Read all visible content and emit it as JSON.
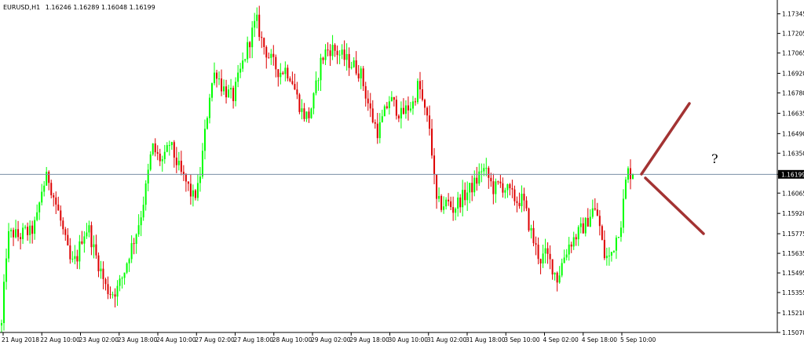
{
  "header": {
    "symbol": "EURUSD,H1",
    "ohlc_readout": "1.16246 1.16289 1.16048 1.16199"
  },
  "annotation": {
    "question_mark": "?"
  },
  "colors": {
    "background": "#ffffff",
    "bull_candle": "#00ff00",
    "bear_candle": "#dd0000",
    "current_price_line": "#7a8fa6",
    "forecast_arrows": "#a33333",
    "axis": "#000000"
  },
  "chart_data": {
    "type": "candlestick",
    "symbol": "EURUSD",
    "timeframe": "H1",
    "current_price": 1.16199,
    "y_range": [
      1.1507,
      1.1741
    ],
    "y_ticks": [
      "1.17345",
      "1.17205",
      "1.17065",
      "1.16920",
      "1.16780",
      "1.16635",
      "1.16490",
      "1.16350",
      "1.16199",
      "1.16065",
      "1.15920",
      "1.15775",
      "1.15635",
      "1.15495",
      "1.15355",
      "1.15210",
      "1.15070"
    ],
    "x_ticks": [
      "21 Aug 2018",
      "22 Aug 10:00",
      "23 Aug 02:00",
      "23 Aug 18:00",
      "24 Aug 10:00",
      "27 Aug 02:00",
      "27 Aug 18:00",
      "28 Aug 10:00",
      "29 Aug 02:00",
      "29 Aug 18:00",
      "30 Aug 10:00",
      "31 Aug 02:00",
      "31 Aug 18:00",
      "3 Sep 10:00",
      "4 Sep 02:00",
      "4 Sep 18:00",
      "5 Sep 10:00"
    ],
    "price_path": [
      1.1512,
      1.1575,
      1.1578,
      1.1575,
      1.1579,
      1.1578,
      1.1586,
      1.161,
      1.1619,
      1.1604,
      1.159,
      1.1572,
      1.1555,
      1.156,
      1.1577,
      1.1582,
      1.1565,
      1.1553,
      1.1539,
      1.1535,
      1.1538,
      1.1548,
      1.1563,
      1.1575,
      1.159,
      1.1612,
      1.164,
      1.1632,
      1.1629,
      1.1642,
      1.1631,
      1.162,
      1.1613,
      1.1603,
      1.161,
      1.1645,
      1.168,
      1.1695,
      1.1683,
      1.1678,
      1.1675,
      1.169,
      1.1704,
      1.1718,
      1.173,
      1.1714,
      1.1705,
      1.1698,
      1.1693,
      1.1695,
      1.169,
      1.1675,
      1.1663,
      1.1661,
      1.1675,
      1.1699,
      1.1708,
      1.171,
      1.1707,
      1.1703,
      1.17,
      1.1697,
      1.1692,
      1.1675,
      1.166,
      1.165,
      1.1662,
      1.1674,
      1.1668,
      1.1662,
      1.1667,
      1.167,
      1.1685,
      1.1665,
      1.1652,
      1.16,
      1.1598,
      1.16,
      1.1595,
      1.1601,
      1.1605,
      1.161,
      1.1615,
      1.1625,
      1.1618,
      1.1609,
      1.1613,
      1.161,
      1.1605,
      1.1601,
      1.1602,
      1.1585,
      1.157,
      1.1559,
      1.1563,
      1.1555,
      1.1545,
      1.156,
      1.157,
      1.1575,
      1.158,
      1.1585,
      1.1595,
      1.159,
      1.1562,
      1.156,
      1.1573,
      1.1587,
      1.1622,
      1.162
    ]
  }
}
